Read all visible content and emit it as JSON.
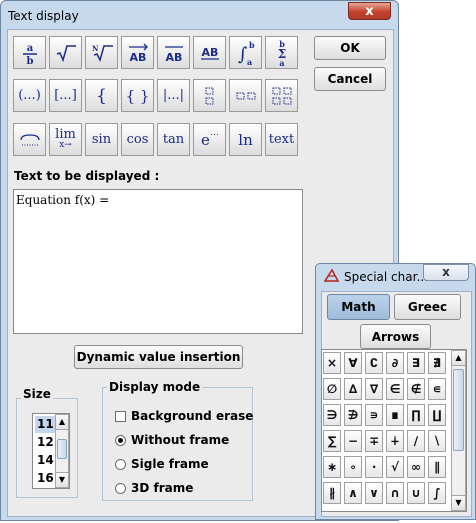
{
  "main_window": {
    "title": "Text display",
    "close_label": "x",
    "ok_label": "OK",
    "cancel_label": "Cancel",
    "toolbar_row1": [
      {
        "icon": "fraction-icon"
      },
      {
        "icon": "square-root-icon"
      },
      {
        "icon": "nth-root-icon"
      },
      {
        "icon": "vector-icon",
        "text": "AB"
      },
      {
        "icon": "segment-icon",
        "text": "AB"
      },
      {
        "icon": "underline-icon",
        "text": "AB"
      },
      {
        "icon": "integral-icon"
      },
      {
        "icon": "sum-icon"
      }
    ],
    "toolbar_row2": [
      {
        "icon": "parentheses-icon",
        "text": "(...)"
      },
      {
        "icon": "brackets-icon",
        "text": "[...]"
      },
      {
        "icon": "left-brace-icon",
        "text": "{"
      },
      {
        "icon": "braces-icon",
        "text": "{ }"
      },
      {
        "icon": "absolute-value-icon",
        "text": "|...|"
      },
      {
        "icon": "matrix-2x1-icon"
      },
      {
        "icon": "matrix-1x2-icon"
      },
      {
        "icon": "matrix-2x2-icon"
      }
    ],
    "toolbar_row3": [
      {
        "icon": "overbrace-icon"
      },
      {
        "icon": "limit-icon",
        "text": "lim",
        "sub": "x→"
      },
      {
        "icon": "sin-icon",
        "text": "sin"
      },
      {
        "icon": "cos-icon",
        "text": "cos"
      },
      {
        "icon": "tan-icon",
        "text": "tan"
      },
      {
        "icon": "exponential-icon",
        "text": "e"
      },
      {
        "icon": "ln-icon",
        "text": "ln"
      },
      {
        "icon": "text-icon",
        "text": "text"
      }
    ],
    "text_label": "Text to be displayed :",
    "text_value": "Equation f(x) =",
    "dynamic_button": "Dynamic value insertion",
    "size_legend": "Size",
    "size_options": [
      "11",
      "12",
      "14",
      "16"
    ],
    "size_selected": "11",
    "display_mode_legend": "Display mode",
    "background_erase": "Background erase",
    "background_erase_checked": false,
    "frame_options": [
      "Without frame",
      "Sigle frame",
      "3D frame"
    ],
    "frame_selected": "Without frame"
  },
  "special_chars": {
    "title": "Special char...",
    "close_label": "x",
    "tabs": [
      "Math",
      "Greec",
      "Arrows"
    ],
    "active_tab": "Math",
    "symbols": [
      [
        "×",
        "∀",
        "∁",
        "∂",
        "∃",
        "∄"
      ],
      [
        "∅",
        "∆",
        "∇",
        "∈",
        "∉",
        "∊"
      ],
      [
        "∋",
        "∌",
        "∍",
        "∎",
        "∏",
        "∐"
      ],
      [
        "∑",
        "−",
        "∓",
        "∔",
        "∕",
        "∖"
      ],
      [
        "∗",
        "∘",
        "∙",
        "√",
        "∞",
        "∥"
      ],
      [
        "∦",
        "∧",
        "∨",
        "∩",
        "∪",
        "∫"
      ]
    ]
  },
  "colors": {
    "window_frame": "#c7d9ec",
    "dialog_bg": "#ebebeb",
    "icon_blue": "#1c2c8a",
    "close_red": "#c4432c",
    "selection": "#c3d6eb"
  }
}
